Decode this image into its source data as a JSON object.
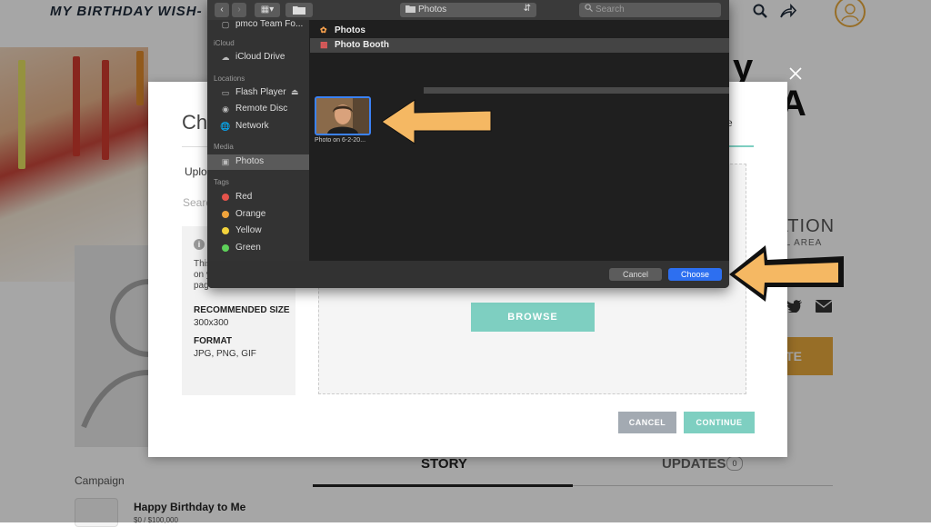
{
  "page": {
    "site_title": "MY BIRTHDAY WISH- DEF",
    "heading_fragment_1": "y",
    "heading_fragment_2": "A",
    "foundation_text": "DATION",
    "foundation_sub": "AL AREA",
    "donate_fragment": "TE",
    "campaign_label": "Campaign",
    "campaign_name": "Happy Birthday to Me",
    "campaign_amount": "$0 / $100,000",
    "tab_story": "STORY",
    "tab_updates": "UPDATES",
    "updates_count": "0",
    "icons": [
      "search-icon",
      "share-icon",
      "avatar-icon",
      "twitter-icon",
      "email-icon"
    ]
  },
  "modal": {
    "title": "Cho",
    "upload_tab": "Uploa",
    "search_label": "Searc",
    "right_tab_fragment": "e",
    "info": {
      "description": "This image will appear on your fundraising page.",
      "rec_size_heading": "RECOMMENDED SIZE",
      "rec_size_value": "300x300",
      "format_heading": "FORMAT",
      "format_value": "JPG, PNG, GIF"
    },
    "browse_label": "BROWSE",
    "cancel_label": "CANCEL",
    "continue_label": "CONTINUE",
    "accent_color": "#7ecfc1"
  },
  "file_dialog": {
    "location": "Photos",
    "search_placeholder": "Search",
    "sidebar": {
      "partial_item": "pmco Team Fo...",
      "icloud_heading": "iCloud",
      "icloud_drive": "iCloud Drive",
      "locations_heading": "Locations",
      "flash_player": "Flash Player",
      "remote_disc": "Remote Disc",
      "network": "Network",
      "media_heading": "Media",
      "photos": "Photos",
      "tags_heading": "Tags",
      "tags": [
        {
          "label": "Red",
          "color": "#e5534b"
        },
        {
          "label": "Orange",
          "color": "#f0a33c"
        },
        {
          "label": "Yellow",
          "color": "#f3d33c"
        },
        {
          "label": "Green",
          "color": "#5ed15a"
        }
      ]
    },
    "column": {
      "items": [
        "Photos",
        "Photo Booth"
      ],
      "selected": "Photo Booth"
    },
    "photo_label": "Photo on 6-2-20...",
    "cancel_label": "Cancel",
    "choose_label": "Choose",
    "choose_color": "#2d6ff0"
  },
  "annotations": {
    "arrow_color": "#f5b863"
  }
}
